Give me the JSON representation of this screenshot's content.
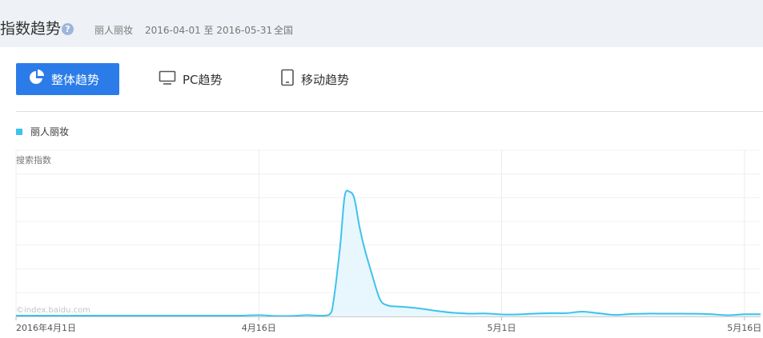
{
  "header": {
    "title": "指数趋势",
    "help_icon": "?",
    "keyword": "丽人丽妆",
    "date_range": "2016-04-01 至 2016-05-31",
    "region": "全国"
  },
  "tabs": [
    {
      "label": "整体趋势",
      "icon": "pie-chart-icon",
      "active": true
    },
    {
      "label": "PC趋势",
      "icon": "monitor-icon",
      "active": false
    },
    {
      "label": "移动趋势",
      "icon": "tablet-icon",
      "active": false
    }
  ],
  "colors": {
    "accent": "#2b7ce9",
    "series": "#3ec2ec",
    "series_fill": "#e8f7fd",
    "header_bg": "#eef1f5"
  },
  "chart_data": {
    "type": "area",
    "title": "",
    "ylabel": "搜索指数",
    "watermark": "©index.baidu.com",
    "grid": true,
    "legend": "top-left",
    "x_tick_labels": [
      "2016年4月1日",
      "4月16日",
      "5月1日",
      "5月16日"
    ],
    "x_tick_days": [
      0,
      15,
      30,
      45
    ],
    "x_range_days": [
      0,
      46
    ],
    "ylim": [
      0,
      100
    ],
    "series": [
      {
        "name": "丽人丽妆",
        "x_days": [
          0,
          1,
          2,
          3,
          4,
          5,
          6,
          7,
          8,
          9,
          10,
          11,
          12,
          13,
          14,
          15,
          16,
          17,
          18,
          19,
          19.5,
          20,
          20.3,
          20.6,
          20.9,
          21.2,
          21.5,
          22,
          22.5,
          23,
          23.5,
          24,
          25,
          26,
          27,
          28,
          29,
          30,
          31,
          32,
          33,
          34,
          35,
          36,
          37,
          38,
          39,
          40,
          41,
          42,
          43,
          44,
          45,
          46
        ],
        "values": [
          0.5,
          0.5,
          0.5,
          0.4,
          0.5,
          0.5,
          0.5,
          0.5,
          0.5,
          0.5,
          0.5,
          0.5,
          0.5,
          0.5,
          0.5,
          0.8,
          0.3,
          0.3,
          0.8,
          0.5,
          3,
          40,
          72,
          75,
          71,
          55,
          42,
          25,
          10,
          6.5,
          6,
          5.7,
          4.7,
          3.3,
          2.2,
          1.7,
          1.8,
          1.2,
          1.2,
          1.7,
          2,
          2,
          2.9,
          1.9,
          0.9,
          1.5,
          1.7,
          1.7,
          1.7,
          1.6,
          1.3,
          0.7,
          1.3,
          1.3
        ]
      }
    ]
  }
}
